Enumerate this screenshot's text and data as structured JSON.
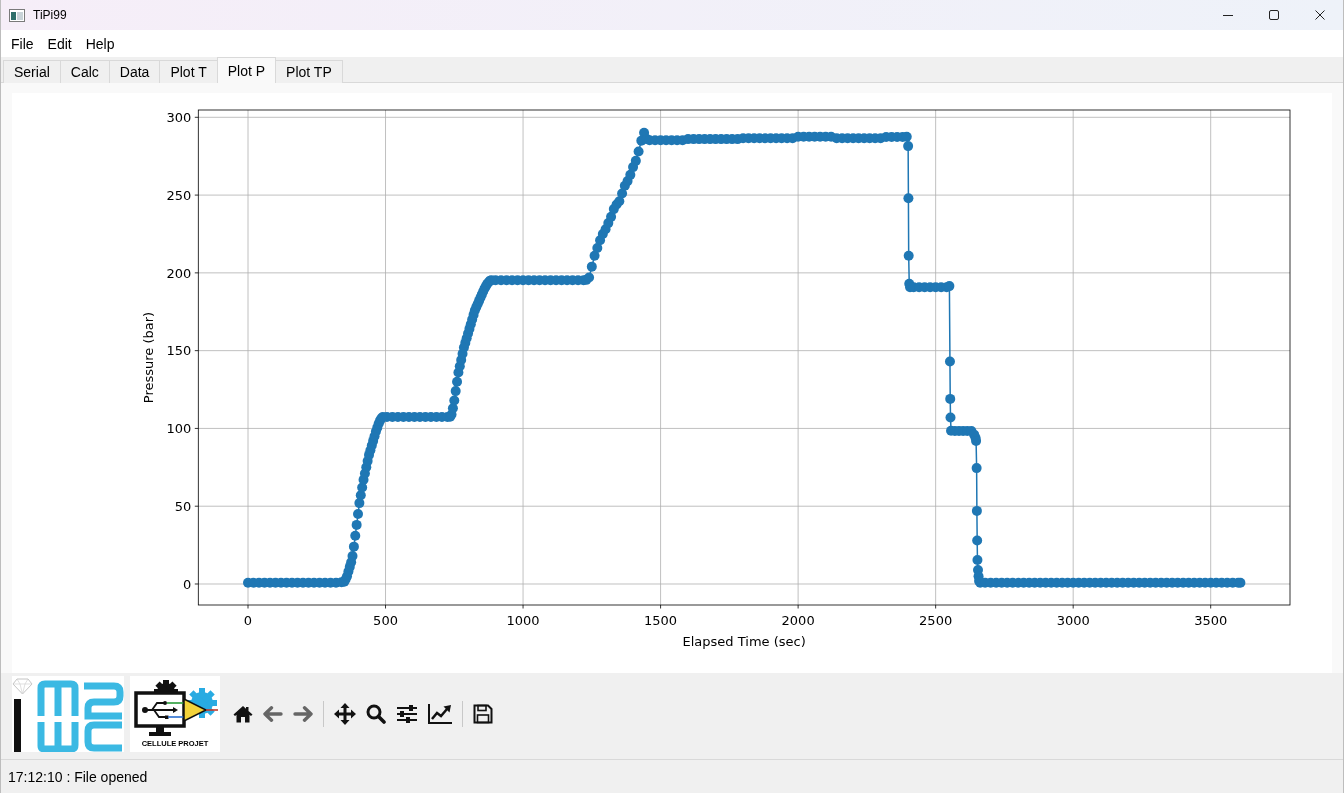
{
  "window": {
    "title": "TiPi99"
  },
  "menu": [
    "File",
    "Edit",
    "Help"
  ],
  "tabs": [
    {
      "label": "Serial",
      "selected": false
    },
    {
      "label": "Calc",
      "selected": false
    },
    {
      "label": "Data",
      "selected": false
    },
    {
      "label": "Plot T",
      "selected": false
    },
    {
      "label": "Plot P",
      "selected": true
    },
    {
      "label": "Plot TP",
      "selected": false
    }
  ],
  "plot": {
    "chart_data": {
      "type": "line",
      "xlabel": "Elapsed Time (sec)",
      "ylabel": "Pressure (bar)",
      "grid": true,
      "xlim": [
        -180.7,
        3788.3
      ],
      "ylim": [
        -13.5,
        304.7
      ],
      "xticks": [
        0,
        500,
        1000,
        1500,
        2000,
        2500,
        3000,
        3500
      ],
      "yticks": [
        0,
        50,
        100,
        150,
        200,
        250,
        300
      ],
      "x": [
        0,
        20,
        40,
        60,
        80,
        100,
        120,
        140,
        160,
        180,
        200,
        220,
        240,
        260,
        280,
        300,
        320,
        340,
        350,
        355,
        360,
        365,
        370,
        375,
        380,
        385,
        390,
        395,
        400,
        405,
        410,
        415,
        420,
        425,
        430,
        435,
        440,
        445,
        450,
        455,
        460,
        465,
        470,
        475,
        480,
        485,
        490,
        505,
        525,
        545,
        565,
        585,
        605,
        625,
        645,
        665,
        685,
        705,
        725,
        735,
        740,
        745,
        750,
        755,
        760,
        765,
        770,
        775,
        780,
        785,
        790,
        795,
        800,
        805,
        810,
        815,
        820,
        825,
        830,
        835,
        840,
        845,
        850,
        855,
        860,
        865,
        870,
        875,
        880,
        885,
        900,
        920,
        940,
        960,
        980,
        1000,
        1020,
        1040,
        1060,
        1080,
        1100,
        1120,
        1140,
        1160,
        1180,
        1200,
        1220,
        1230,
        1240,
        1250,
        1260,
        1270,
        1280,
        1290,
        1300,
        1310,
        1320,
        1330,
        1340,
        1350,
        1360,
        1370,
        1380,
        1390,
        1400,
        1410,
        1420,
        1430,
        1440,
        1450,
        1460,
        1480,
        1500,
        1520,
        1540,
        1560,
        1580,
        1600,
        1620,
        1640,
        1660,
        1680,
        1700,
        1720,
        1740,
        1760,
        1780,
        1800,
        1820,
        1840,
        1860,
        1880,
        1900,
        1920,
        1940,
        1960,
        1980,
        2000,
        2020,
        2040,
        2060,
        2080,
        2100,
        2120,
        2140,
        2160,
        2180,
        2200,
        2220,
        2240,
        2260,
        2280,
        2300,
        2320,
        2340,
        2360,
        2380,
        2395,
        2400,
        2401,
        2402,
        2404,
        2407,
        2420,
        2440,
        2460,
        2480,
        2500,
        2520,
        2540,
        2550,
        2552,
        2553,
        2554,
        2556,
        2570,
        2585,
        2600,
        2615,
        2630,
        2640,
        2645,
        2647,
        2649,
        2650,
        2651,
        2652,
        2654,
        2656,
        2658,
        2662,
        2680,
        2700,
        2720,
        2740,
        2760,
        2780,
        2800,
        2820,
        2840,
        2860,
        2880,
        2900,
        2920,
        2940,
        2960,
        2980,
        3000,
        3020,
        3040,
        3060,
        3080,
        3100,
        3120,
        3140,
        3160,
        3180,
        3200,
        3220,
        3240,
        3260,
        3280,
        3300,
        3320,
        3340,
        3360,
        3380,
        3400,
        3420,
        3440,
        3460,
        3480,
        3500,
        3520,
        3540,
        3560,
        3580,
        3600,
        3608
      ],
      "series": [
        {
          "color": "#1f77b4",
          "marker": "o",
          "values": [
            0.8,
            0.8,
            0.8,
            0.8,
            0.8,
            0.8,
            0.8,
            0.8,
            0.8,
            0.8,
            0.8,
            0.8,
            0.8,
            0.8,
            0.8,
            0.8,
            0.8,
            1.2,
            1.5,
            3,
            5,
            8,
            11,
            14,
            18,
            24,
            31,
            38,
            45,
            52,
            57,
            62,
            67,
            71,
            75,
            79,
            83,
            86,
            89,
            92,
            95,
            98,
            100.5,
            103,
            105,
            106.5,
            107.3,
            107.3,
            107.3,
            107.3,
            107.3,
            107.3,
            107.3,
            107.3,
            107.3,
            107.3,
            107.3,
            107.3,
            107.3,
            107.5,
            109,
            113,
            118,
            124,
            130,
            136,
            140,
            144,
            148,
            152,
            155,
            158,
            161,
            164,
            167,
            170,
            173,
            176,
            178,
            180,
            182,
            184,
            186,
            188,
            190,
            191.5,
            193,
            194,
            195,
            195.3,
            195.3,
            195.3,
            195.3,
            195.3,
            195.3,
            195.3,
            195.3,
            195.3,
            195.3,
            195.3,
            195.3,
            195.3,
            195.3,
            195.3,
            195.3,
            195.3,
            195.3,
            195.5,
            197,
            204,
            211,
            216,
            221,
            225,
            228,
            232,
            236,
            241,
            244,
            246,
            251,
            256,
            259,
            263,
            268,
            272,
            278,
            285,
            290,
            286,
            285.2,
            285.2,
            285.2,
            285.2,
            285.2,
            285.2,
            285.2,
            286,
            286,
            286,
            286,
            286,
            286,
            286,
            286,
            286,
            286,
            286.5,
            286.5,
            286.5,
            286.5,
            286.5,
            286.5,
            286.5,
            286.5,
            286.5,
            286.5,
            287.5,
            287.5,
            287.5,
            287.5,
            287.5,
            287.5,
            287.5,
            286.5,
            286.5,
            286.5,
            286.5,
            286.5,
            286.5,
            286.5,
            286.5,
            286.5,
            287.3,
            287.3,
            287.3,
            287.3,
            287.5,
            281.5,
            248,
            211,
            193,
            190.8,
            190.8,
            190.8,
            190.8,
            190.8,
            190.8,
            190.8,
            190.8,
            191.5,
            143,
            119,
            107,
            98.5,
            98.3,
            98.3,
            98.3,
            98.3,
            98.3,
            96,
            94,
            92,
            74.5,
            47,
            28,
            15.4,
            9,
            5,
            2,
            0.8,
            0.8,
            0.8,
            0.8,
            0.8,
            0.8,
            0.8,
            0.8,
            0.8,
            0.8,
            0.8,
            0.8,
            0.8,
            0.8,
            0.8,
            0.8,
            0.8,
            0.8,
            0.8,
            0.8,
            0.8,
            0.8,
            0.8,
            0.8,
            0.8,
            0.8,
            0.8,
            0.8,
            0.8,
            0.8,
            0.8,
            0.8,
            0.8,
            0.8,
            0.8,
            0.8,
            0.8,
            0.8,
            0.8,
            0.8,
            0.8,
            0.8,
            0.8,
            0.8,
            0.8,
            0.8,
            0.8,
            0.8,
            0.8
          ]
        }
      ]
    }
  },
  "toolbar": {
    "logo_caption": "CELLULE PROJET"
  },
  "status_bar": "17:12:10 : File opened"
}
